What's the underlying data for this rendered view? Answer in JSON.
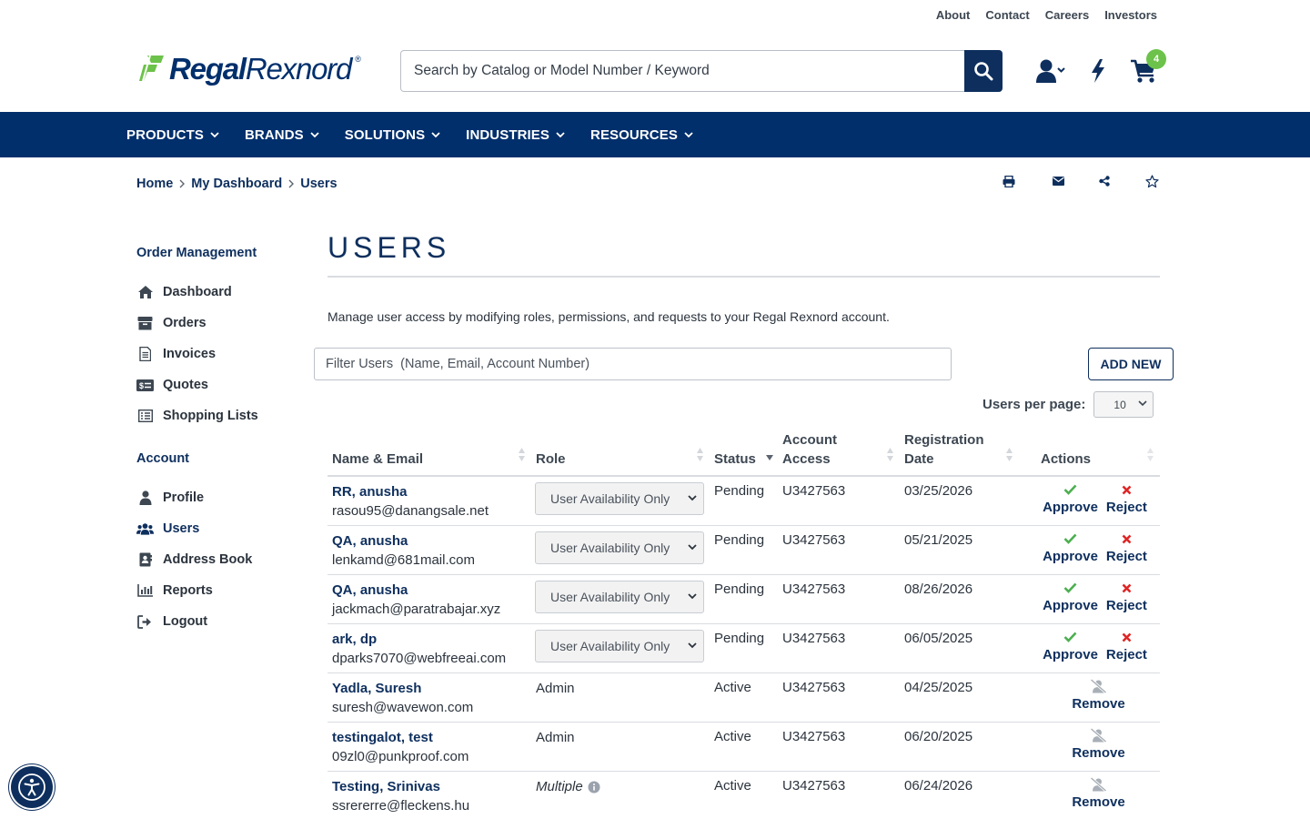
{
  "utility_links": [
    "About",
    "Contact",
    "Careers",
    "Investors"
  ],
  "logo": {
    "part1": "Regal",
    "part2": "Rexnord"
  },
  "search": {
    "placeholder": "Search by Catalog or Model Number / Keyword"
  },
  "cart": {
    "count": "4"
  },
  "nav": [
    "PRODUCTS",
    "BRANDS",
    "SOLUTIONS",
    "INDUSTRIES",
    "RESOURCES"
  ],
  "breadcrumb": {
    "home": "Home",
    "dashboard": "My Dashboard",
    "current": "Users"
  },
  "sidebar": {
    "order_head": "Order Management",
    "order_items": [
      {
        "label": "Dashboard",
        "icon": "home-icon"
      },
      {
        "label": "Orders",
        "icon": "box-icon"
      },
      {
        "label": "Invoices",
        "icon": "invoice-icon"
      },
      {
        "label": "Quotes",
        "icon": "quote-icon"
      },
      {
        "label": "Shopping Lists",
        "icon": "list-icon"
      }
    ],
    "account_head": "Account",
    "account_items": [
      {
        "label": "Profile",
        "icon": "user-icon"
      },
      {
        "label": "Users",
        "icon": "users-icon",
        "active": true
      },
      {
        "label": "Address Book",
        "icon": "address-book-icon"
      },
      {
        "label": "Reports",
        "icon": "chart-icon"
      },
      {
        "label": "Logout",
        "icon": "logout-icon"
      }
    ]
  },
  "main": {
    "title": "USERS",
    "intro": "Manage user access by modifying roles, permissions, and requests to your Regal Rexnord account.",
    "filter_placeholder": "Filter Users  (Name, Email, Account Number)",
    "add_new": "ADD NEW",
    "per_page_label": "Users per page:",
    "per_page_value": "10"
  },
  "table": {
    "headers": {
      "name_email": "Name & Email",
      "role": "Role",
      "status": "Status",
      "account_line1": "Account",
      "account_line2": "Access",
      "reg_line1": "Registration",
      "reg_line2": "Date",
      "actions": "Actions"
    },
    "rows": [
      {
        "name": "RR, anusha",
        "email": "rasou95@danangsale.net",
        "role": "User Availability Only",
        "role_type": "select",
        "status": "Pending",
        "account": "U3427563",
        "date": "03/25/2026",
        "actions": [
          "Approve",
          "Reject"
        ]
      },
      {
        "name": "QA, anusha",
        "email": "lenkamd@681mail.com",
        "role": "User Availability Only",
        "role_type": "select",
        "status": "Pending",
        "account": "U3427563",
        "date": "05/21/2025",
        "actions": [
          "Approve",
          "Reject"
        ]
      },
      {
        "name": "QA, anusha",
        "email": "jackmach@paratrabajar.xyz",
        "role": "User Availability Only",
        "role_type": "select",
        "status": "Pending",
        "account": "U3427563",
        "date": "08/26/2026",
        "actions": [
          "Approve",
          "Reject"
        ]
      },
      {
        "name": "ark, dp",
        "email": "dparks7070@webfreeai.com",
        "role": "User Availability Only",
        "role_type": "select",
        "status": "Pending",
        "account": "U3427563",
        "date": "06/05/2025",
        "actions": [
          "Approve",
          "Reject"
        ]
      },
      {
        "name": "Yadla, Suresh",
        "email": "suresh@wavewon.com",
        "role": "Admin",
        "role_type": "text",
        "status": "Active",
        "account": "U3427563",
        "date": "04/25/2025",
        "actions": [
          "Remove"
        ]
      },
      {
        "name": "testingalot, test",
        "email": "09zl0@punkproof.com",
        "role": "Admin",
        "role_type": "text",
        "status": "Active",
        "account": "U3427563",
        "date": "06/20/2025",
        "actions": [
          "Remove"
        ]
      },
      {
        "name": "Testing, Srinivas",
        "email": "ssrererre@fleckens.hu",
        "role": "Multiple",
        "role_type": "multi",
        "status": "Active",
        "account": "U3427563",
        "date": "06/24/2026",
        "actions": [
          "Remove"
        ]
      }
    ]
  },
  "colors": {
    "brand_navy": "#002f6c",
    "brand_green": "#6cc24a",
    "approve": "#4caf50",
    "reject": "#e02424"
  }
}
